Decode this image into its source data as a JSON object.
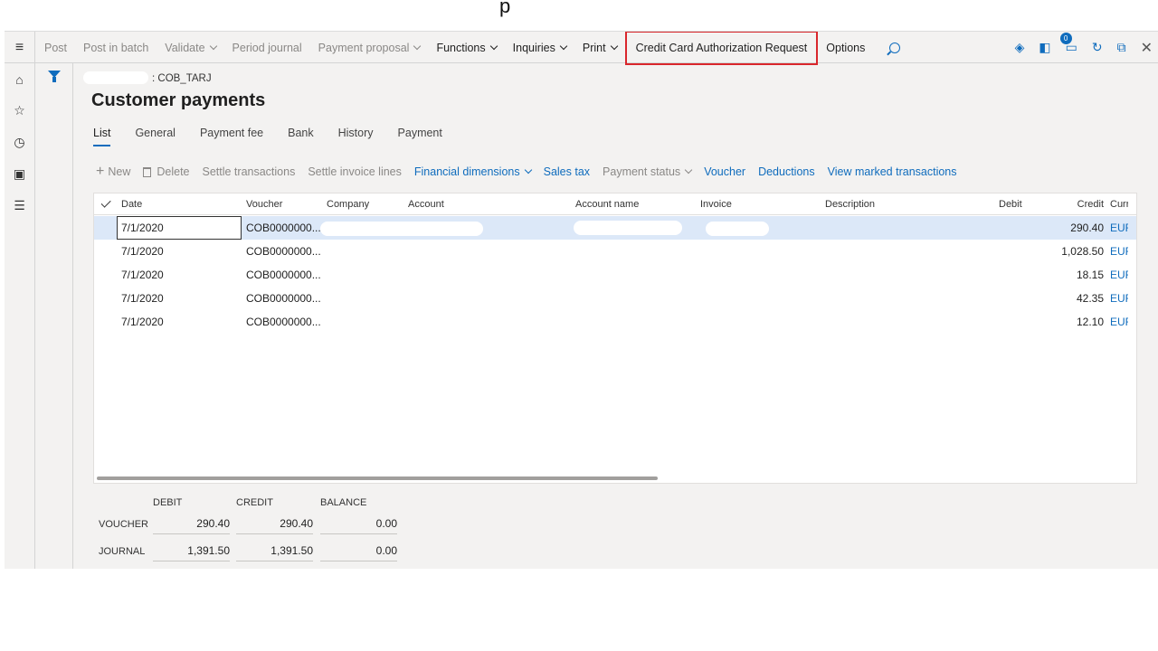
{
  "actionbar": {
    "items": [
      {
        "label": "Post",
        "disabled": true
      },
      {
        "label": "Post in batch",
        "disabled": true
      },
      {
        "label": "Validate",
        "disabled": true,
        "dropdown": true
      },
      {
        "label": "Period journal",
        "disabled": true
      },
      {
        "label": "Payment proposal",
        "disabled": true,
        "dropdown": true
      },
      {
        "label": "Functions",
        "dropdown": true
      },
      {
        "label": "Inquiries",
        "dropdown": true
      },
      {
        "label": "Print",
        "dropdown": true
      },
      {
        "label": "Credit Card Authorization Request",
        "highlight": true
      },
      {
        "label": "Options"
      }
    ],
    "badge_count": "0"
  },
  "breadcrumb": ": COB_TARJ",
  "page_title": "Customer payments",
  "tabs": [
    "List",
    "General",
    "Payment fee",
    "Bank",
    "History",
    "Payment"
  ],
  "toolbar": {
    "new": "New",
    "delete": "Delete",
    "settle_transactions": "Settle transactions",
    "settle_invoice_lines": "Settle invoice lines",
    "financial_dimensions": "Financial dimensions",
    "sales_tax": "Sales tax",
    "payment_status": "Payment status",
    "voucher": "Voucher",
    "deductions": "Deductions",
    "view_marked": "View marked transactions"
  },
  "grid": {
    "columns": [
      "Date",
      "Voucher",
      "Company",
      "Account",
      "Account name",
      "Invoice",
      "Description",
      "Debit",
      "Credit",
      "Curr"
    ],
    "rows": [
      {
        "date": "7/1/2020",
        "voucher": "COB0000000...",
        "credit": "290.40",
        "currency": "EUR"
      },
      {
        "date": "7/1/2020",
        "voucher": "COB0000000...",
        "credit": "1,028.50",
        "currency": "EUR"
      },
      {
        "date": "7/1/2020",
        "voucher": "COB0000000...",
        "credit": "18.15",
        "currency": "EUR"
      },
      {
        "date": "7/1/2020",
        "voucher": "COB0000000...",
        "credit": "42.35",
        "currency": "EUR"
      },
      {
        "date": "7/1/2020",
        "voucher": "COB0000000...",
        "credit": "12.10",
        "currency": "EUR"
      }
    ]
  },
  "totals": {
    "headers": [
      "DEBIT",
      "CREDIT",
      "BALANCE"
    ],
    "voucher": {
      "label": "VOUCHER",
      "debit": "290.40",
      "credit": "290.40",
      "balance": "0.00"
    },
    "journal": {
      "label": "JOURNAL",
      "debit": "1,391.50",
      "credit": "1,391.50",
      "balance": "0.00"
    }
  },
  "colors": {
    "accent": "#0f6cbd",
    "highlight_box": "#d9262c",
    "selected_row": "#dce8f8"
  }
}
